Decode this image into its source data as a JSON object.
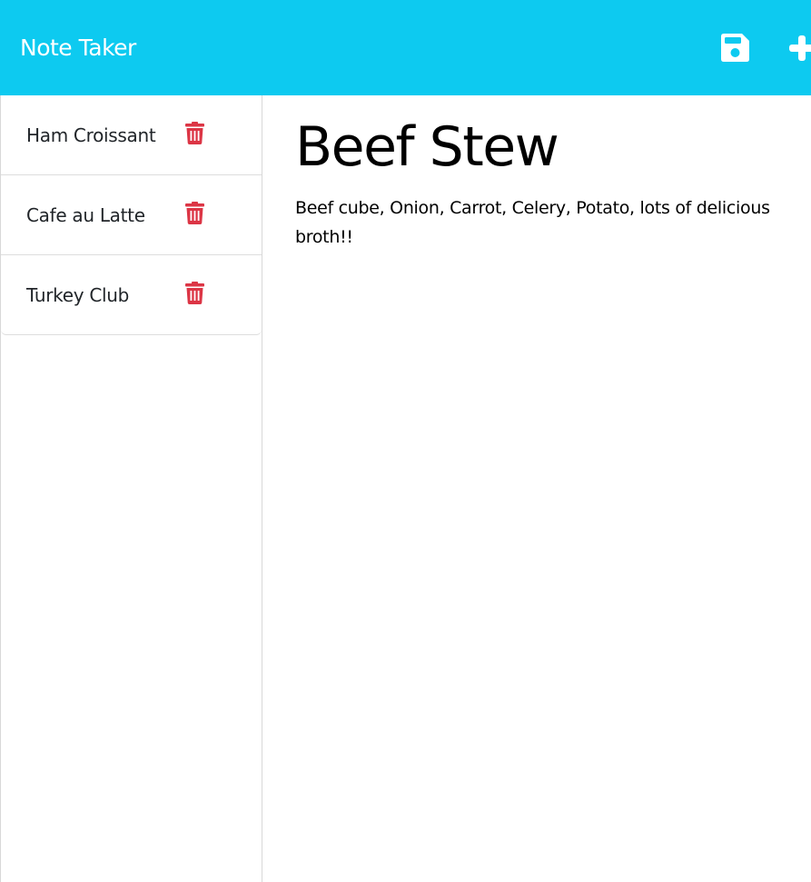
{
  "navbar": {
    "brand": "Note Taker",
    "background_color": "#0dcaf0",
    "save_icon": "floppy-disk-icon",
    "new_icon": "plus-icon"
  },
  "sidebar": {
    "notes": [
      {
        "title": "Ham Croissant",
        "delete_icon": "trash-icon"
      },
      {
        "title": "Cafe au Latte",
        "delete_icon": "trash-icon"
      },
      {
        "title": "Turkey Club",
        "delete_icon": "trash-icon"
      }
    ],
    "delete_color": "#dc3545"
  },
  "main": {
    "note_title": "Beef Stew",
    "note_text": "Beef cube, Onion, Carrot, Celery, Potato, lots of delicious broth!!"
  }
}
